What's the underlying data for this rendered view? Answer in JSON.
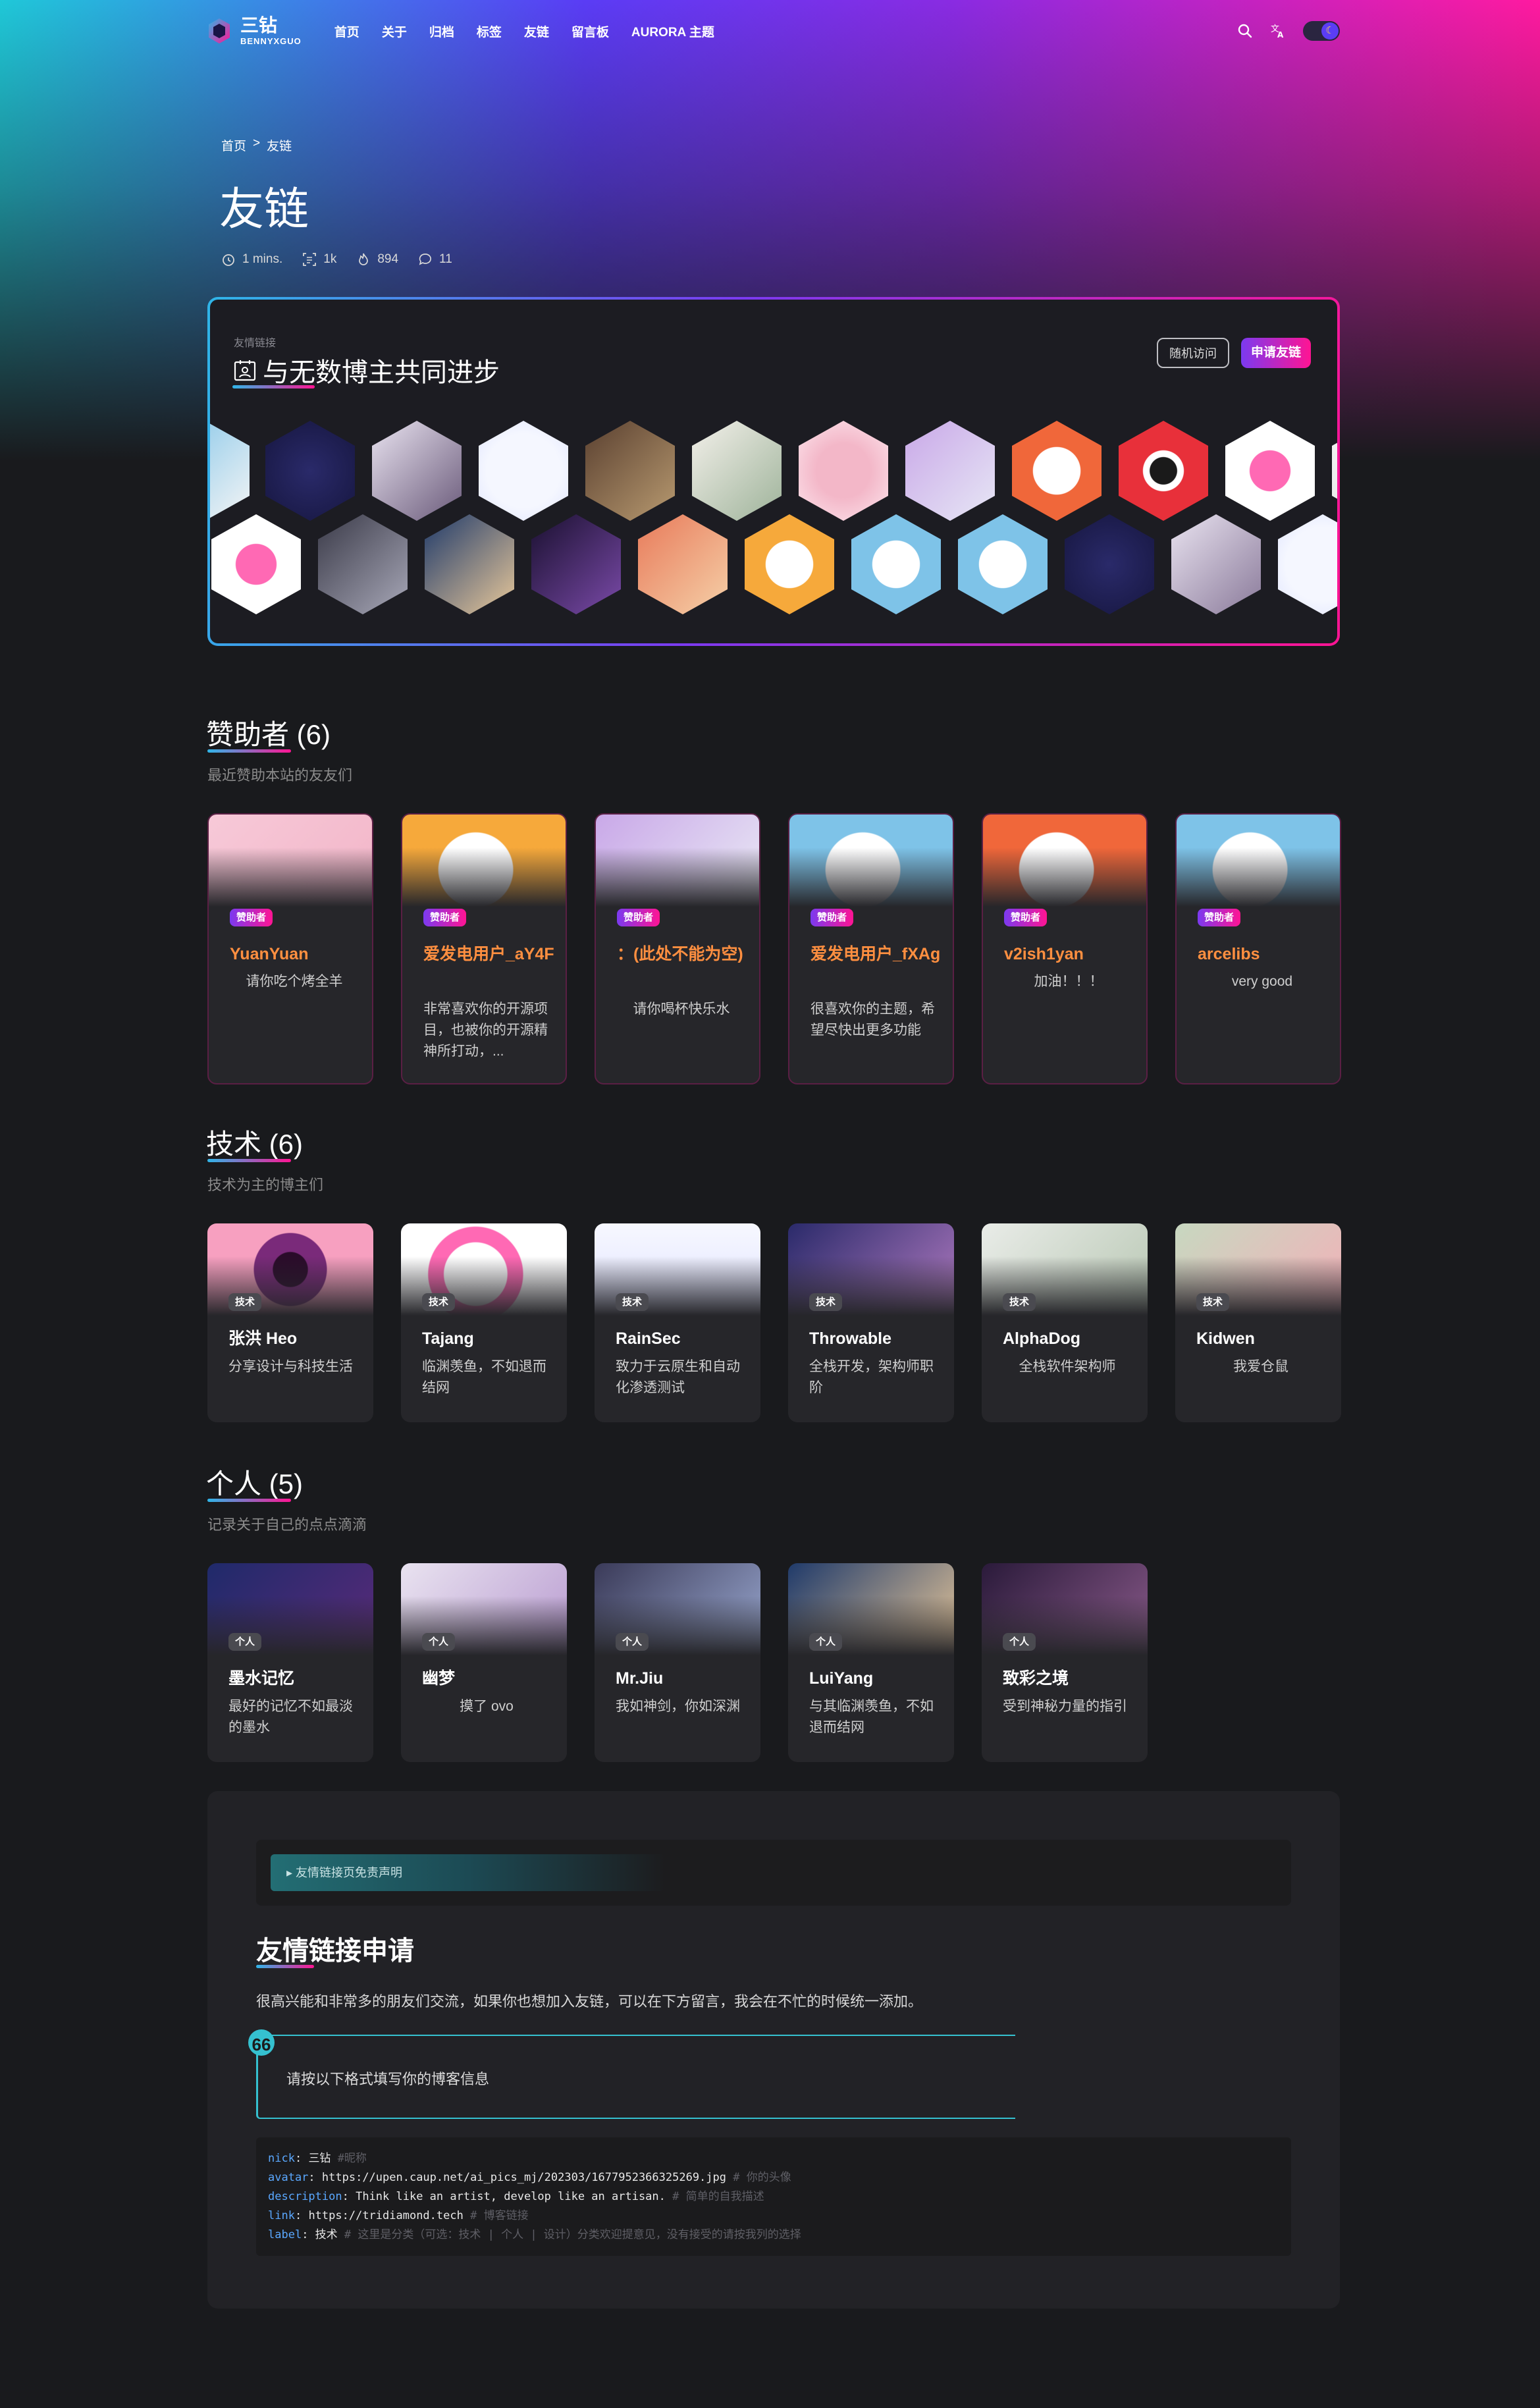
{
  "nav": {
    "logo_title": "三钻",
    "logo_sub": "BENNYXGUO",
    "links": [
      "首页",
      "关于",
      "归档",
      "标签",
      "友链",
      "留言板",
      "AURORA 主题"
    ],
    "icons": [
      "search-icon",
      "translate-icon",
      "theme-toggle-icon"
    ]
  },
  "breadcrumb": {
    "home": "首页",
    "sep": ">",
    "current": "友链"
  },
  "page": {
    "title": "友链",
    "meta": {
      "read_time": "1 mins.",
      "words": "1k",
      "views": "894",
      "comments": "11"
    }
  },
  "banner": {
    "small": "友情链接",
    "title": "与无数博主共同进步",
    "random_button": "随机访问",
    "apply_button": "申请友链"
  },
  "sponsors": {
    "title": "赞助者 (6)",
    "desc": "最近赞助本站的友友们",
    "items": [
      {
        "badge": "赞助者",
        "name": "YuanYuan",
        "desc": "请你吃个烤全羊"
      },
      {
        "badge": "赞助者",
        "name": "爱发电用户_aY4F",
        "desc": "非常喜欢你的开源项目，也被你的开源精神所打动，..."
      },
      {
        "badge": "赞助者",
        "name": "：(此处不能为空)",
        "desc": "请你喝杯快乐水"
      },
      {
        "badge": "赞助者",
        "name": "爱发电用户_fXAg",
        "desc": "很喜欢你的主题，希望尽快出更多功能"
      },
      {
        "badge": "赞助者",
        "name": "v2ish1yan",
        "desc": "加油！！！"
      },
      {
        "badge": "赞助者",
        "name": "arcelibs",
        "desc": "very good"
      }
    ]
  },
  "tech": {
    "title": "技术 (6)",
    "desc": "技术为主的博主们",
    "items": [
      {
        "badge": "技术",
        "name": "张洪 Heo",
        "desc": "分享设计与科技生活"
      },
      {
        "badge": "技术",
        "name": "Tajang",
        "desc": "临渊羡鱼，不如退而结网"
      },
      {
        "badge": "技术",
        "name": "RainSec",
        "desc": "致力于云原生和自动化渗透测试"
      },
      {
        "badge": "技术",
        "name": "Throwable",
        "desc": "全栈开发，架构师职阶"
      },
      {
        "badge": "技术",
        "name": "AlphaDog",
        "desc": "全栈软件架构师"
      },
      {
        "badge": "技术",
        "name": "Kidwen",
        "desc": "我爱仓鼠"
      }
    ]
  },
  "personal": {
    "title": "个人 (5)",
    "desc": "记录关于自己的点点滴滴",
    "items": [
      {
        "badge": "个人",
        "name": "墨水记忆",
        "desc": "最好的记忆不如最淡的墨水"
      },
      {
        "badge": "个人",
        "name": "幽梦",
        "desc": "摸了 ovo"
      },
      {
        "badge": "个人",
        "name": "Mr.Jiu",
        "desc": "我如神剑，你如深渊"
      },
      {
        "badge": "个人",
        "name": "LuiYang",
        "desc": "与其临渊羡鱼，不如退而结网"
      },
      {
        "badge": "个人",
        "name": "致彩之境",
        "desc": "受到神秘力量的指引"
      }
    ]
  },
  "apply": {
    "disclaimer": "▸ 友情链接页免责声明",
    "title": "友情链接申请",
    "intro": "很高兴能和非常多的朋友们交流，如果你也想加入友链，可以在下方留言，我会在不忙的时候统一添加。",
    "quote_mark": "66",
    "quote": "请按以下格式填写你的博客信息",
    "code": [
      {
        "key": "nick",
        "value": "三钻",
        "comment": "#昵称"
      },
      {
        "key": "avatar",
        "value": "https://upen.caup.net/ai_pics_mj/202303/1677952366325269.jpg",
        "comment": "# 你的头像"
      },
      {
        "key": "description",
        "value": "Think like an artist, develop like an artisan.",
        "comment": "# 简单的自我描述"
      },
      {
        "key": "link",
        "value": "https://tridiamond.tech",
        "comment": "# 博客链接"
      },
      {
        "key": "label",
        "value": "技术",
        "comment": "# 这里是分类（可选：技术 | 个人 | 设计）分类欢迎提意见，没有接受的请按我列的选择"
      }
    ]
  },
  "colors": {
    "accent_cyan": "#2fb5e8",
    "accent_pink": "#ff1493",
    "sponsor_name": "#ff8f40",
    "bg": "#191a1d"
  }
}
